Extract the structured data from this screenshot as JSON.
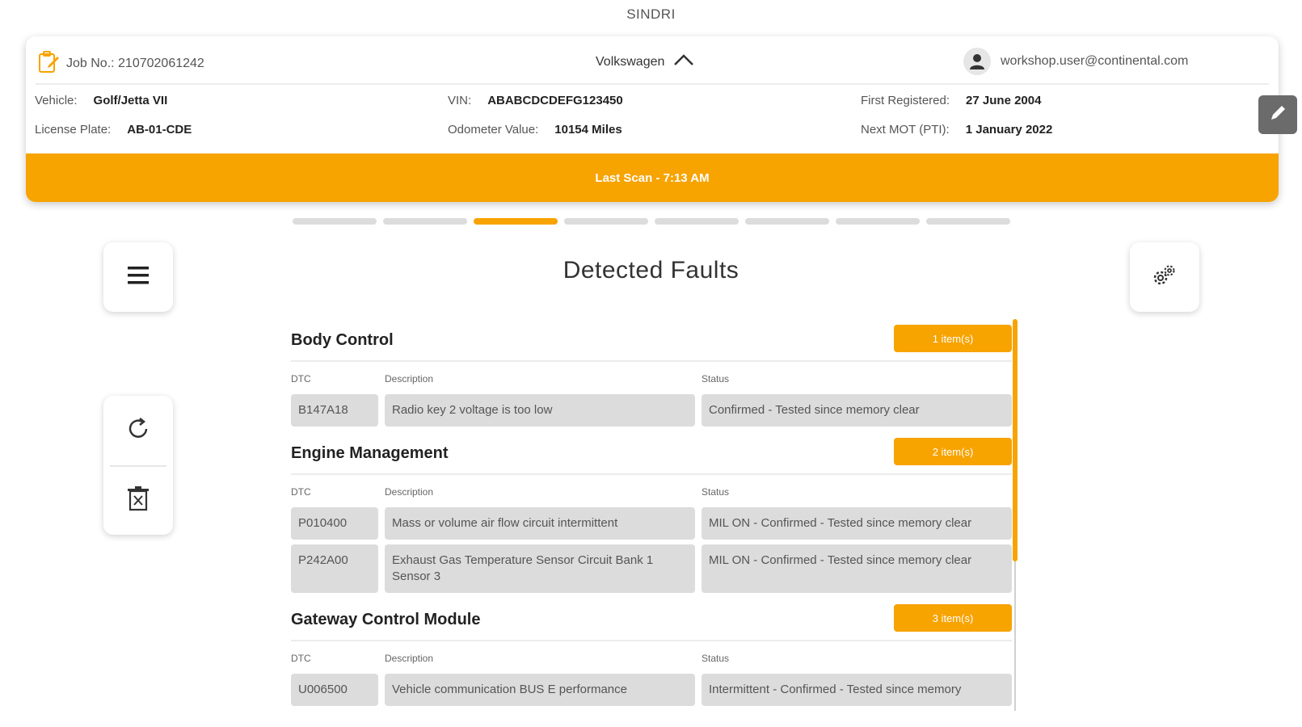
{
  "app": {
    "title": "SINDRI"
  },
  "header": {
    "job_label": "Job No.: 210702061242",
    "make": "Volkswagen",
    "user_email": "workshop.user@continental.com",
    "vehicle_label": "Vehicle:",
    "vehicle_value": "Golf/Jetta VII",
    "license_label": "License Plate:",
    "license_value": "AB-01-CDE",
    "vin_label": "VIN:",
    "vin_value": "ABABCDCDEFG123450",
    "odometer_label": "Odometer Value:",
    "odometer_value": "10154 Miles",
    "first_registered_label": "First Registered:",
    "first_registered_value": "27 June 2004",
    "next_mot_label": "Next MOT (PTI):",
    "next_mot_value": "1 January 2022",
    "scan_text": "Last Scan - 7:13 AM"
  },
  "steps": {
    "total": 8,
    "active_index": 2
  },
  "page": {
    "title": "Detected Faults"
  },
  "columns": {
    "dtc": "DTC",
    "description": "Description",
    "status": "Status"
  },
  "groups": [
    {
      "name": "Body Control",
      "count_label": "1 item(s)",
      "rows": [
        {
          "dtc": "B147A18",
          "description": "Radio key 2 voltage is too low",
          "status": "Confirmed - Tested since memory clear"
        }
      ]
    },
    {
      "name": "Engine Management",
      "count_label": "2 item(s)",
      "rows": [
        {
          "dtc": "P010400",
          "description": "Mass or volume air flow circuit intermittent",
          "status": "MIL ON - Confirmed - Tested since memory clear"
        },
        {
          "dtc": "P242A00",
          "description": "Exhaust Gas Temperature Sensor Circuit Bank 1 Sensor 3",
          "status": "MIL ON - Confirmed - Tested since memory clear"
        }
      ]
    },
    {
      "name": "Gateway Control Module",
      "count_label": "3 item(s)",
      "rows": [
        {
          "dtc": "U006500",
          "description": "Vehicle communication BUS E performance",
          "status": "Intermittent - Confirmed - Tested since memory"
        }
      ]
    }
  ],
  "colors": {
    "accent": "#f7a300",
    "edit_button": "#6b6b6b",
    "cell_bg": "#dcdcdc"
  },
  "icons": {
    "job": "clipboard-edit-icon",
    "make_toggle": "chevron-up-icon",
    "user": "user-icon",
    "edit": "pencil-icon",
    "menu": "hamburger-menu-icon",
    "settings": "gears-icon",
    "refresh": "refresh-icon",
    "delete": "trash-icon"
  }
}
